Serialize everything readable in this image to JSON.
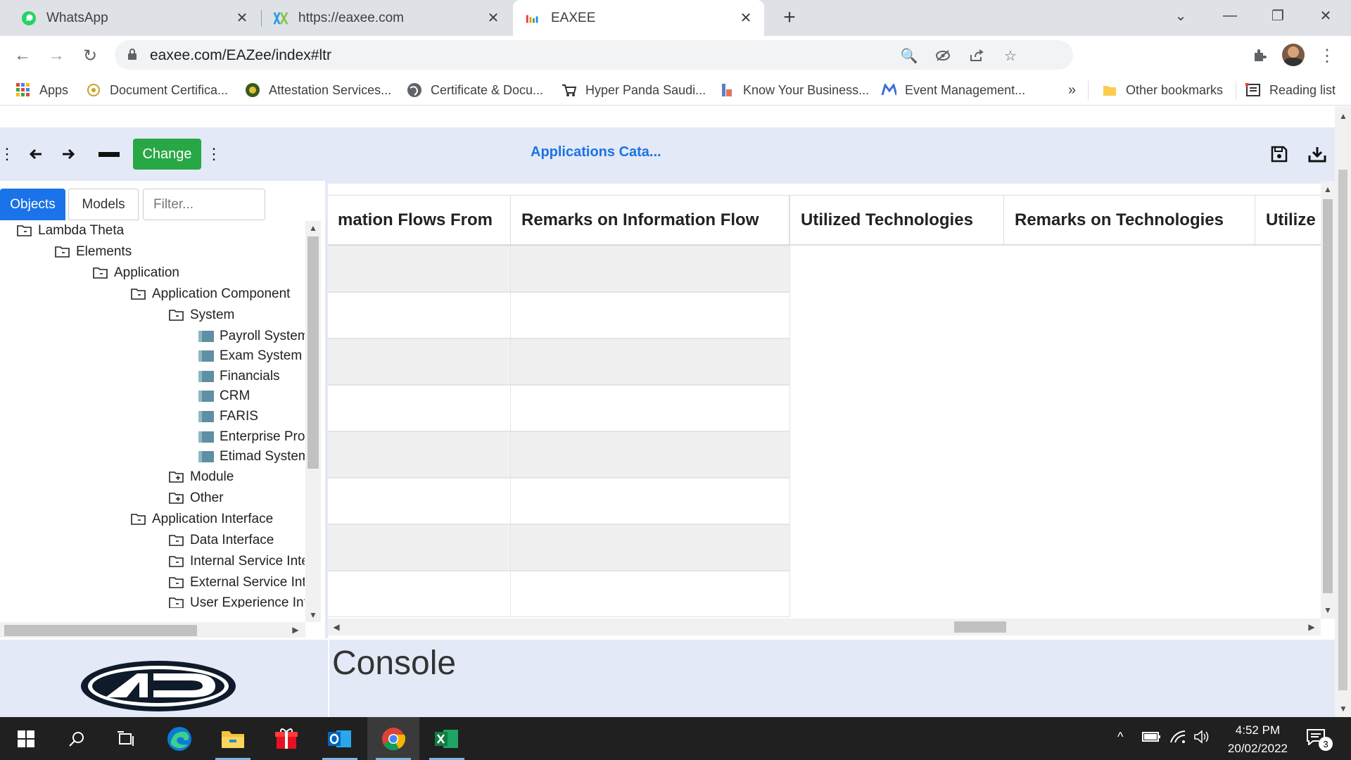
{
  "browser": {
    "tabs": [
      {
        "title": "WhatsApp",
        "icon": "whatsapp-icon"
      },
      {
        "title": "https://eaxee.com",
        "icon": "eaxee-icon"
      },
      {
        "title": "EAXEE",
        "icon": "eaxee-icon"
      }
    ],
    "new_tab": "+",
    "url": "eaxee.com/EAZee/index#ltr",
    "bookmarks": [
      {
        "label": "Apps"
      },
      {
        "label": "Document Certifica..."
      },
      {
        "label": "Attestation Services..."
      },
      {
        "label": "Certificate & Docu..."
      },
      {
        "label": "Hyper Panda Saudi..."
      },
      {
        "label": "Know Your Business..."
      },
      {
        "label": "Event Management..."
      }
    ],
    "more_bookmarks": "»",
    "other_bookmarks": "Other bookmarks",
    "reading_list": "Reading list"
  },
  "app": {
    "change_button": "Change",
    "title": "Applications Cata...",
    "tabs": [
      "Objects",
      "Models"
    ],
    "filter_placeholder": "Filter...",
    "tree": [
      {
        "label": "Lambda Theta",
        "type": "folder"
      },
      {
        "label": "Elements",
        "type": "folder"
      },
      {
        "label": "Application",
        "type": "folder"
      },
      {
        "label": "Application Component",
        "type": "folder"
      },
      {
        "label": "System",
        "type": "folder"
      },
      {
        "label": "Payroll System",
        "type": "leaf"
      },
      {
        "label": "Exam System",
        "type": "leaf"
      },
      {
        "label": "Financials",
        "type": "leaf"
      },
      {
        "label": "CRM",
        "type": "leaf"
      },
      {
        "label": "FARIS",
        "type": "leaf"
      },
      {
        "label": "Enterprise Pro",
        "type": "leaf"
      },
      {
        "label": "Etimad System",
        "type": "leaf"
      },
      {
        "label": "Module",
        "type": "folder-plus"
      },
      {
        "label": "Other",
        "type": "folder-plus"
      },
      {
        "label": "Application Interface",
        "type": "folder"
      },
      {
        "label": "Data Interface",
        "type": "folder"
      },
      {
        "label": "Internal Service Inte",
        "type": "folder"
      },
      {
        "label": "External Service Int",
        "type": "folder"
      },
      {
        "label": "User Experience Int",
        "type": "folder"
      }
    ],
    "grid_headers": [
      "mation Flows From",
      "Remarks on Information Flow",
      "Utilized Technologies",
      "Remarks on Technologies",
      "Utilize"
    ],
    "console_title": "Console"
  },
  "taskbar": {
    "time": "4:52 PM",
    "date": "20/02/2022",
    "notification_count": "3"
  }
}
